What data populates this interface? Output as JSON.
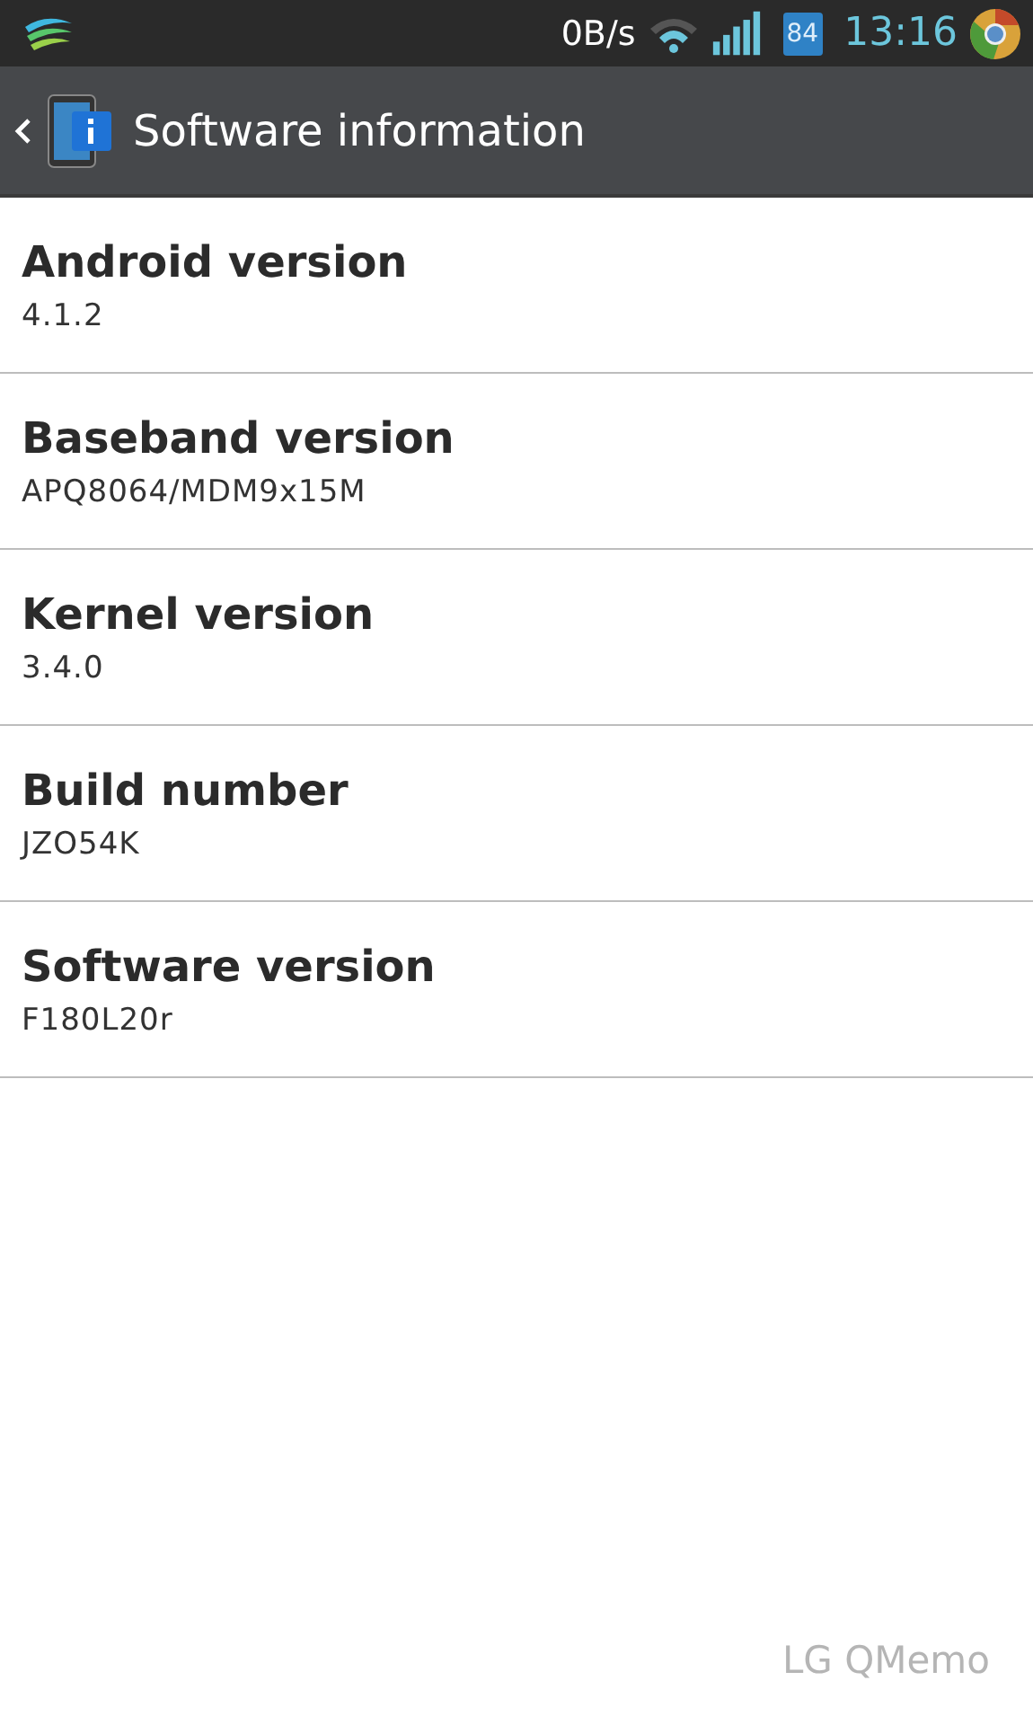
{
  "status_bar": {
    "speed": "0B/s",
    "battery": "84",
    "time": "13:16"
  },
  "header": {
    "title": "Software information"
  },
  "items": [
    {
      "title": "Android version",
      "value": "4.1.2"
    },
    {
      "title": "Baseband version",
      "value": "APQ8064/MDM9x15M"
    },
    {
      "title": "Kernel version",
      "value": "3.4.0"
    },
    {
      "title": "Build number",
      "value": "JZO54K"
    },
    {
      "title": "Software version",
      "value": "F180L20r"
    }
  ],
  "memo_mark": "LG QMemo"
}
